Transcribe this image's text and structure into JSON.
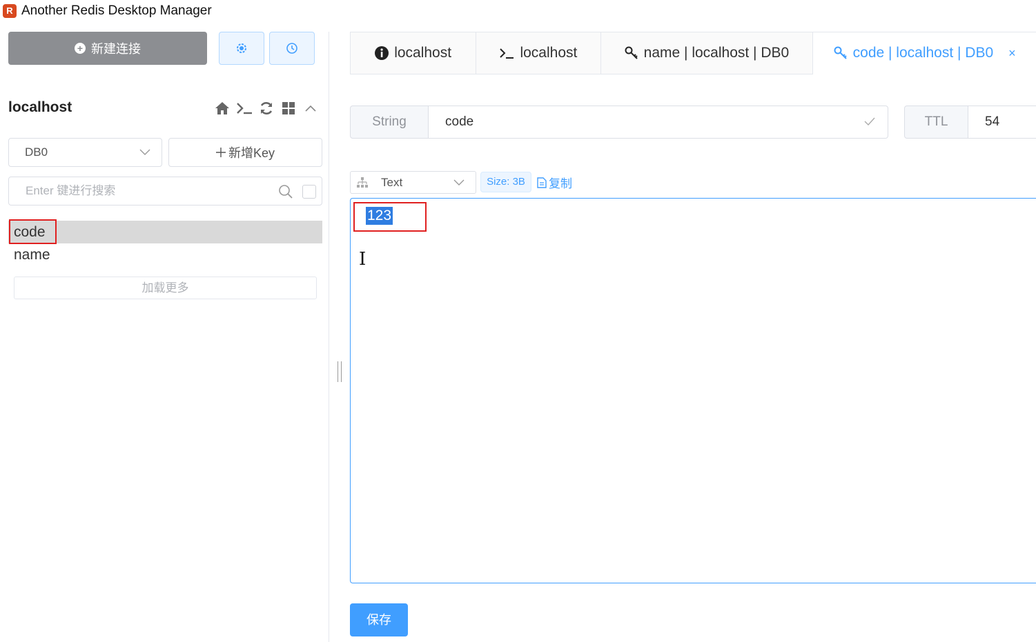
{
  "window": {
    "title": "Another Redis Desktop Manager",
    "logo_glyph": "R"
  },
  "sidebar": {
    "new_connection_label": "新建连接",
    "connection_name": "localhost",
    "db_select": {
      "value": "DB0"
    },
    "add_key_label": "新增Key",
    "search": {
      "placeholder": "Enter 键进行搜索"
    },
    "keys": [
      {
        "name": "code",
        "selected": true
      },
      {
        "name": "name",
        "selected": false
      }
    ],
    "load_more_label": "加载更多"
  },
  "tabs": [
    {
      "label": "localhost",
      "icon": "info-icon",
      "active": false
    },
    {
      "label": "localhost",
      "icon": "terminal-icon",
      "active": false
    },
    {
      "label": "name | localhost | DB0",
      "icon": "key-icon",
      "active": false
    },
    {
      "label": "code | localhost | DB0",
      "icon": "key-icon",
      "active": true,
      "close_glyph": "×"
    }
  ],
  "key_detail": {
    "type_label": "String",
    "key_name": "code",
    "ttl_label": "TTL",
    "ttl_value": "54",
    "format": "Text",
    "size_label": "Size: 3B",
    "copy_label": "复制",
    "value": "123",
    "save_label": "保存"
  },
  "colors": {
    "accent": "#409eff",
    "highlight_border": "#e02020",
    "selection": "#2f7de1",
    "new_conn_bg": "#8c8e92"
  }
}
